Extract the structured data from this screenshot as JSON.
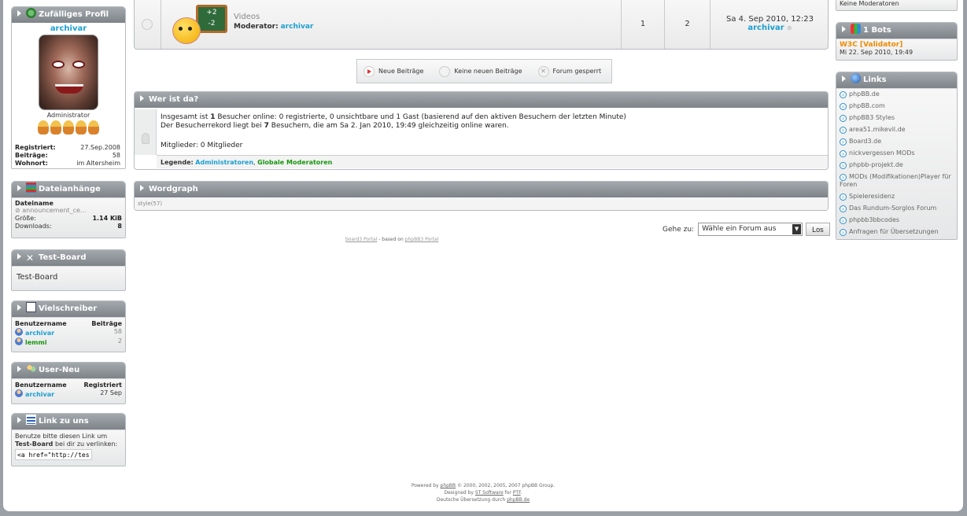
{
  "left": {
    "profile": {
      "title": "Zufälliges Profil",
      "username": "archivar",
      "rank": "Administrator",
      "fields": [
        {
          "label": "Registriert:",
          "value": "27.Sep.2008"
        },
        {
          "label": "Beiträge:",
          "value": "58"
        },
        {
          "label": "Wohnort:",
          "value": "im Altersheim"
        }
      ]
    },
    "attachments": {
      "title": "Dateianhänge",
      "header": "Dateiname",
      "file": "announcement_ce...",
      "size_label": "Größe:",
      "size_value": "1.14 KiB",
      "downloads_label": "Downloads:",
      "downloads_value": "8"
    },
    "testboard": {
      "title": "Test-Board",
      "text": "Test-Board"
    },
    "vielschreiber": {
      "title": "Vielschreiber",
      "col1": "Benutzername",
      "col2": "Beiträge",
      "rows": [
        {
          "name": "archivar",
          "value": "58"
        },
        {
          "name": "lemmi",
          "value": "2"
        }
      ]
    },
    "userneu": {
      "title": "User-Neu",
      "col1": "Benutzername",
      "col2": "Registriert",
      "rows": [
        {
          "name": "archivar",
          "value": "27 Sep"
        }
      ]
    },
    "linkzuuns": {
      "title": "Link zu uns",
      "text1": "Benutze bitte diesen Link um",
      "board": "Test-Board",
      "text2": "bei dir zu verlinken:",
      "code": "<a href=\"http://test.jwh"
    }
  },
  "center": {
    "forum": {
      "name": "Videos",
      "moderator_label": "Moderator:",
      "moderator": "archivar",
      "topics": "1",
      "posts": "2",
      "last_date": "Sa 4. Sep 2010, 12:23",
      "last_user": "archivar"
    },
    "legend": {
      "new": "Neue Beiträge",
      "nonew": "Keine neuen Beiträge",
      "locked": "Forum gesperrt"
    },
    "whoisonline": {
      "title": "Wer ist da?",
      "line1_pre": "Insgesamt ist ",
      "line1_num": "1",
      "line1_post": " Besucher online: 0 registrierte, 0 unsichtbare und 1 Gast (basierend auf den aktiven Besuchern der letzten Minute)",
      "line2_pre": "Der Besucherrekord liegt bei ",
      "line2_num": "7",
      "line2_post": " Besuchern, die am Sa 2. Jan 2010, 19:49 gleichzeitig online waren.",
      "members": "Mitglieder: 0 Mitglieder",
      "legend_label": "Legende:",
      "legend_admin": "Administratoren",
      "legend_sep": ", ",
      "legend_mod": "Globale Moderatoren"
    },
    "wordgraph": {
      "title": "Wordgraph",
      "text": "style(57)"
    },
    "jump": {
      "label": "Gehe zu:",
      "select": "Wähle ein Forum aus",
      "button": "Los"
    },
    "portal_credit": {
      "link1": "board3 Portal",
      "mid": " - based on ",
      "link2": "phpBB3 Portal"
    }
  },
  "right": {
    "moderators_text": "Keine Moderatoren",
    "bots": {
      "title": "1 Bots",
      "name": "W3C [Validator]",
      "date": "Mi 22. Sep 2010, 19:49"
    },
    "links": {
      "title": "Links",
      "items": [
        "phpBB.de",
        "phpBB.com",
        "phpBB3 Styles",
        "area51.mikevil.de",
        "Board3.de",
        "nickvergessen MODs",
        "phpbb-projekt.de",
        "MODs (Modifikationen)Player für Foren",
        "Spieleresidenz",
        "Das Rundum-Sorglos Forum",
        "phpbb3bbcodes",
        "Anfragen für Übersetzungen"
      ]
    }
  },
  "footer": {
    "line1_pre": "Powered by ",
    "line1_link": "phpBB",
    "line1_post": " © 2000, 2002, 2005, 2007 phpBB Group.",
    "line2_pre": "Designed by ",
    "line2_link1": "ST Software",
    "line2_mid": " for ",
    "line2_link2": "PTF",
    "line2_end": ".",
    "line3_pre": "Deutsche Übersetzung durch ",
    "line3_link": "phpBB.de"
  }
}
